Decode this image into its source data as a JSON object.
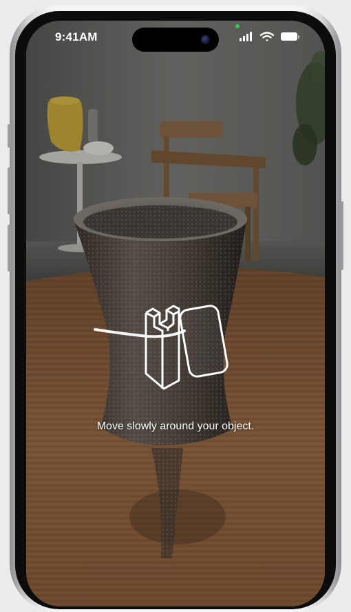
{
  "status_bar": {
    "time": "9:41AM",
    "icons": [
      "cellular-signal-icon",
      "wifi-icon",
      "battery-icon"
    ],
    "privacy_indicator_color": "#34c759"
  },
  "camera": {
    "instruction": "Move slowly around your object.",
    "guide_icon": "object-capture-icon"
  },
  "colors": {
    "background": "#ececee",
    "frame": "#f4f4f6",
    "text": "#ffffff",
    "table_wood": "#8a5a38"
  }
}
